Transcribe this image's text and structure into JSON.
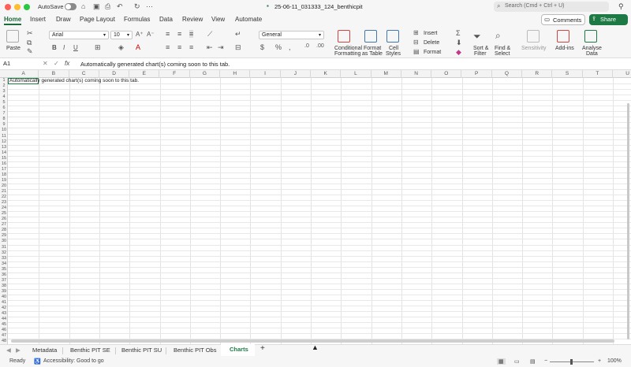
{
  "titlebar": {
    "autosave": "AutoSave",
    "doc_title": "25-06-11_031333_124_benthicpit",
    "search_placeholder": "Search (Cmd + Ctrl + U)"
  },
  "ribbon_tabs": [
    "Home",
    "Insert",
    "Draw",
    "Page Layout",
    "Formulas",
    "Data",
    "Review",
    "View",
    "Automate"
  ],
  "header_buttons": {
    "comments": "Comments",
    "share": "Share"
  },
  "ribbon": {
    "paste": "Paste",
    "font": "Arial",
    "size": "10",
    "number_format": "General",
    "conditional": "Conditional",
    "conditional2": "Formatting",
    "format_table": "Format",
    "format_table2": "as Table",
    "cell_styles": "Cell",
    "cell_styles2": "Styles",
    "insert": "Insert",
    "delete": "Delete",
    "format": "Format",
    "sort": "Sort &",
    "sort2": "Filter",
    "find": "Find &",
    "find2": "Select",
    "sensitivity": "Sensitivity",
    "addins": "Add-ins",
    "analyse": "Analyse",
    "analyse2": "Data"
  },
  "formula": {
    "cell_ref": "A1",
    "fx": "fx",
    "content": "Automatically generated chart(s) coming soon to this tab."
  },
  "grid": {
    "columns": [
      "A",
      "B",
      "C",
      "D",
      "E",
      "F",
      "G",
      "H",
      "I",
      "J",
      "K",
      "L",
      "M",
      "N",
      "O",
      "P",
      "Q",
      "R",
      "S",
      "T",
      "U"
    ],
    "rows": 48,
    "a1_text": "Automatically generated chart(s) coming soon to this tab."
  },
  "sheets": [
    "Metadata",
    "Benthic PIT SE",
    "Benthic PIT SU",
    "Benthic PIT Obs",
    "Charts"
  ],
  "active_sheet": "Charts",
  "status": {
    "ready": "Ready",
    "accessibility": "Accessibility: Good to go",
    "zoom": "100%"
  },
  "colors": {
    "accent": "#1e7a45"
  }
}
